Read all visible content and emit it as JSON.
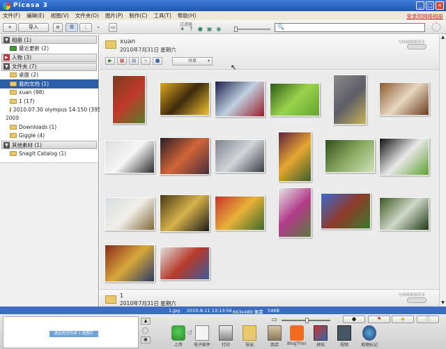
{
  "app": {
    "title": "Picasa 3"
  },
  "menu": {
    "items": [
      "文件(F)",
      "编辑(E)",
      "视图(V)",
      "文件夹(O)",
      "图片(P)",
      "制作(C)",
      "工具(T)",
      "帮助(H)"
    ],
    "signin": "登录到网络相册"
  },
  "toolbar": {
    "import_label": "导入",
    "filter_label": "过滤器",
    "search_placeholder": ""
  },
  "sidebar": {
    "sections": [
      {
        "label": "相册 (1)",
        "items": [
          {
            "label": "最近更新 (2)"
          }
        ]
      },
      {
        "label": "人物 (3)",
        "items": []
      },
      {
        "label": "文件夹 (7)",
        "items": [
          {
            "label": "桌面 (2)"
          },
          {
            "label": "我的文档 (1)",
            "selected": true
          },
          {
            "label": "xuan (98)"
          },
          {
            "label": "1 (17)"
          },
          {
            "label": "2010.07.30 olympus 14-150 (395)"
          }
        ]
      },
      {
        "year": "2009",
        "items": [
          {
            "label": "Downloads (1)"
          },
          {
            "label": "Giggle (4)"
          }
        ]
      },
      {
        "label": "其他素材 (1)",
        "items": [
          {
            "label": "Snagit Catalog (1)"
          }
        ]
      }
    ]
  },
  "folder": {
    "title": "xuan",
    "date": "2010年7月31日 星期六",
    "hint": "与网络相册同步",
    "share_label": "共享"
  },
  "next_folder": {
    "title": "1",
    "date": "2010年7月31日 星期六",
    "hint": "与网络相册同步"
  },
  "thumbnails": [
    {
      "name": "thumb-fruit-market",
      "colors": [
        "#7a3b1e",
        "#c0392b",
        "#5a7d2a"
      ]
    },
    {
      "name": "thumb-sunflowers",
      "colors": [
        "#e0a81e",
        "#3d2a0d",
        "#f2c230"
      ]
    },
    {
      "name": "thumb-colored-tiles",
      "colors": [
        "#1b1e4a",
        "#c0d0e0",
        "#9d1c28"
      ]
    },
    {
      "name": "thumb-green-leaf",
      "colors": [
        "#2d5a18",
        "#9bd34d",
        "#63a430"
      ]
    },
    {
      "name": "thumb-street-flowers",
      "colors": [
        "#8a8a8a",
        "#5d5d66",
        "#c4b35a"
      ]
    },
    {
      "name": "thumb-kitchen-interior",
      "colors": [
        "#8d5a32",
        "#e6d7c0",
        "#6b3b1e"
      ]
    },
    {
      "name": "thumb-offices-sign",
      "colors": [
        "#dedede",
        "#f5f5f5",
        "#2a2a2a"
      ]
    },
    {
      "name": "thumb-sunset-sky",
      "colors": [
        "#2a1d24",
        "#d1653a",
        "#4a2d3a"
      ]
    },
    {
      "name": "thumb-buildings",
      "colors": [
        "#7c8390",
        "#d3d5d8",
        "#3a4048"
      ]
    },
    {
      "name": "thumb-flower-stand",
      "colors": [
        "#5d1f40",
        "#e5a630",
        "#3b5e2b"
      ]
    },
    {
      "name": "thumb-trees",
      "colors": [
        "#2e4e1c",
        "#88a860",
        "#cfe2b8"
      ]
    },
    {
      "name": "thumb-leaf-on-book",
      "colors": [
        "#111111",
        "#e8e8e8",
        "#5fa030"
      ]
    },
    {
      "name": "thumb-bottle",
      "colors": [
        "#d7dce3",
        "#f1efe8",
        "#806a3a"
      ]
    },
    {
      "name": "thumb-shop-front",
      "colors": [
        "#4a3a18",
        "#d6b24a",
        "#1a1a1a"
      ]
    },
    {
      "name": "thumb-fruit-crates",
      "colors": [
        "#c4342a",
        "#e8b23a",
        "#3a6a2a"
      ]
    },
    {
      "name": "thumb-pink-flowers",
      "colors": [
        "#e4e4e4",
        "#b23a8a",
        "#5a7a3a"
      ]
    },
    {
      "name": "thumb-brick-house",
      "colors": [
        "#3a6ad6",
        "#8e3a2a",
        "#3a7a2a"
      ]
    },
    {
      "name": "thumb-mushroom",
      "colors": [
        "#3a5a20",
        "#d0d8c8",
        "#1e3a14"
      ]
    },
    {
      "name": "thumb-bookshelf",
      "colors": [
        "#8a2a1a",
        "#d8a83a",
        "#2a3a6a"
      ]
    },
    {
      "name": "thumb-tools-flatlay",
      "colors": [
        "#e0e0e0",
        "#b83a2a",
        "#3a5a9a"
      ]
    }
  ],
  "status": {
    "filename": "1.jpg",
    "datetime": "2010-8-11 13:13:56",
    "dimensions": "663x489 像素",
    "filesize": "54KB"
  },
  "tray": {
    "selection_label": "选定的文件夹 1 张图片",
    "tools": [
      "上传",
      "电子邮件",
      "打印",
      "导出",
      "商店",
      "BlogThis!",
      "拼贴",
      "视频",
      "地理标记"
    ]
  }
}
